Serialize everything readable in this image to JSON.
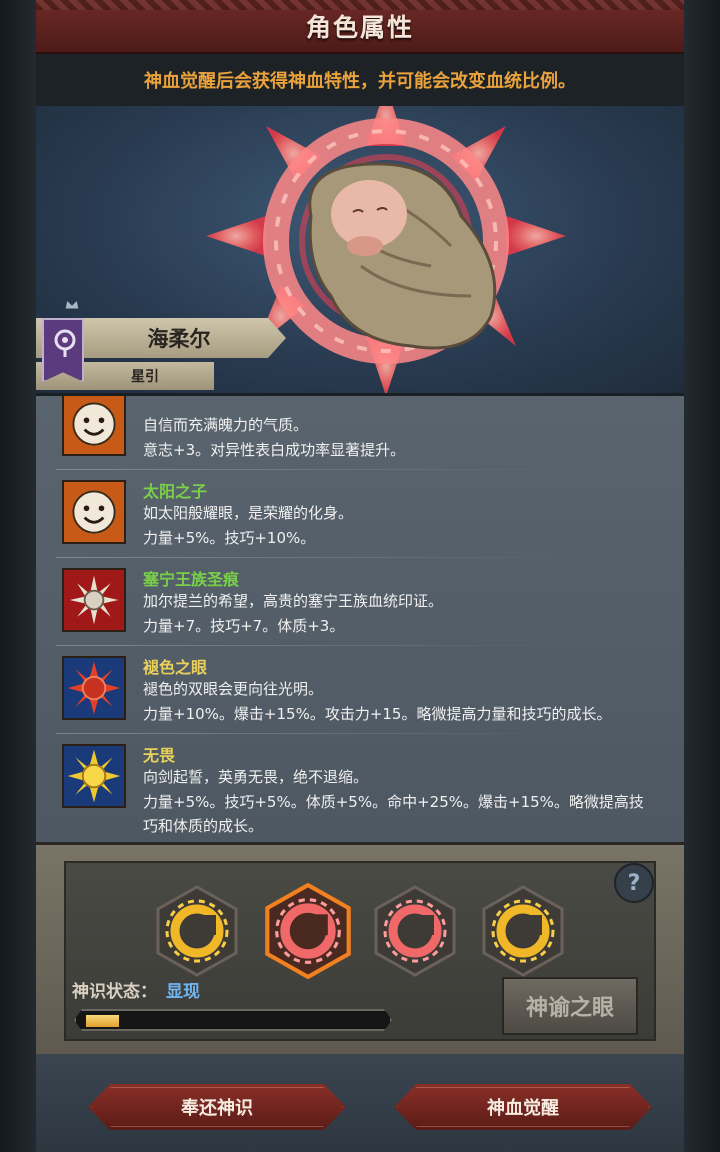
{
  "header": {
    "title": "角色属性"
  },
  "notice": {
    "text": "神血觉醒后会获得神血特性，并可能会改变血统比例。"
  },
  "character": {
    "name": "海柔尔",
    "subtitle": "星引"
  },
  "traits": [
    {
      "name": "",
      "desc": "自信而充满魄力的气质。",
      "effect": "意志+3。对异性表白成功率显著提升。",
      "icon": "smiley-sun-icon",
      "name_color": "#7bd04a"
    },
    {
      "name": "太阳之子",
      "desc": "如太阳般耀眼，是荣耀的化身。",
      "effect": "力量+5%。技巧+10%。",
      "icon": "smiley-sun-icon",
      "name_color": "#7bd04a"
    },
    {
      "name": "塞宁王族圣痕",
      "desc": "加尔提兰的希望，高贵的塞宁王族血统印证。",
      "effect": "力量+7。技巧+7。体质+3。",
      "icon": "white-sun-crest-icon",
      "name_color": "#7bd04a"
    },
    {
      "name": "褪色之眼",
      "desc": "褪色的双眼会更向往光明。",
      "effect": "力量+10%。爆击+15%。攻击力+15。略微提高力量和技巧的成长。",
      "icon": "red-sun-eye-icon",
      "name_color": "#e8d05a"
    },
    {
      "name": "无畏",
      "desc": "向剑起誓，英勇无畏，绝不退缩。",
      "effect": "力量+5%。技巧+5%。体质+5%。命中+25%。爆击+15%。略微提高技巧和体质的成长。",
      "icon": "gold-sun-icon",
      "name_color": "#e8d05a"
    }
  ],
  "sigils": [
    {
      "icon": "gold-sun-sigil-icon",
      "selected": false
    },
    {
      "icon": "red-sun-sigil-icon",
      "selected": true
    },
    {
      "icon": "red-sun-sigil-icon",
      "selected": false
    },
    {
      "icon": "gold-sun-sigil-icon",
      "selected": false
    }
  ],
  "status": {
    "label": "神识状态：",
    "value": "显现",
    "progress": 0.11
  },
  "oracle_button": {
    "label": "神谕之眼"
  },
  "help": {
    "label": "?"
  },
  "actions": {
    "return_label": "奉还神识",
    "awaken_label": "神血觉醒"
  },
  "colors": {
    "accent_red": "#8a2f28",
    "notice_orange": "#e9a23c",
    "status_blue": "#70b4f0"
  }
}
